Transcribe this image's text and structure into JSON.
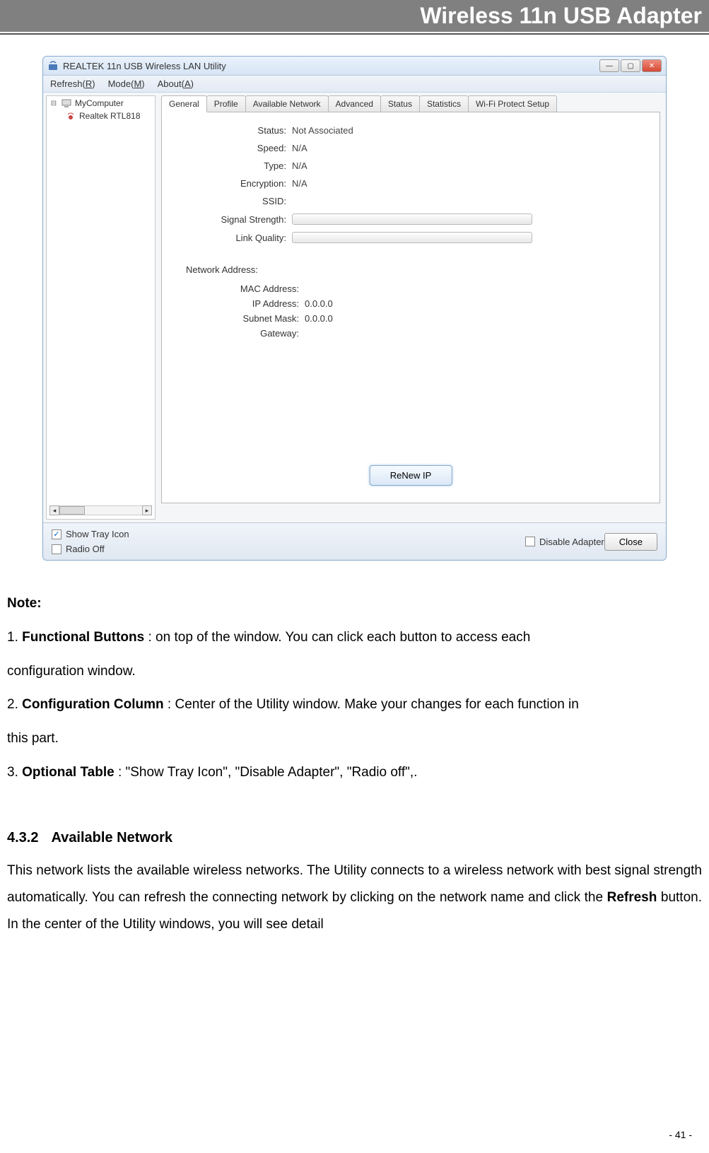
{
  "header": {
    "title": "Wireless 11n USB Adapter"
  },
  "app": {
    "window_title": "REALTEK 11n USB Wireless LAN Utility",
    "menubar": {
      "refresh": "Refresh(R)",
      "mode": "Mode(M)",
      "about": "About(A)"
    },
    "tree": {
      "root": "MyComputer",
      "child": "Realtek RTL818"
    },
    "tabs": {
      "general": "General",
      "profile": "Profile",
      "available_network": "Available Network",
      "advanced": "Advanced",
      "status": "Status",
      "statistics": "Statistics",
      "wifi_protect": "Wi-Fi Protect Setup"
    },
    "general": {
      "status_label": "Status:",
      "status_value": "Not Associated",
      "speed_label": "Speed:",
      "speed_value": "N/A",
      "type_label": "Type:",
      "type_value": "N/A",
      "encryption_label": "Encryption:",
      "encryption_value": "N/A",
      "ssid_label": "SSID:",
      "ssid_value": "",
      "signal_label": "Signal Strength:",
      "link_label": "Link Quality:",
      "network_address_label": "Network Address:",
      "mac_label": "MAC Address:",
      "mac_value": "",
      "ip_label": "IP Address:",
      "ip_value": "0.0.0.0",
      "subnet_label": "Subnet Mask:",
      "subnet_value": "0.0.0.0",
      "gateway_label": "Gateway:",
      "gateway_value": "",
      "renew_button": "ReNew IP"
    },
    "bottom": {
      "show_tray": "Show Tray Icon",
      "radio_off": "Radio Off",
      "disable_adapter": "Disable Adapter",
      "close": "Close"
    }
  },
  "doc": {
    "note_heading": "Note:",
    "item1_prefix": "1. ",
    "item1_bold": "Functional Buttons",
    "item1_rest": " : on top of the window. You can click each button to access each",
    "item1_line2": "configuration window.",
    "item2_prefix": "2. ",
    "item2_bold": "Configuration Column",
    "item2_rest": " : Center of the Utility window. Make your changes for each function in",
    "item2_line2": "this part.",
    "item3_prefix": "3. ",
    "item3_bold": "Optional Table",
    "item3_rest": " : \"Show Tray Icon\", \"Disable Adapter\", \"Radio off\",.",
    "section_num": "4.3.2",
    "section_title": "Available Network",
    "section_body_1": "This network lists the available wireless networks. The Utility connects to a wireless network with best signal strength automatically. You can refresh the connecting network by clicking on the network name and click the ",
    "section_body_bold": "Refresh",
    "section_body_2": " button. In the center of the Utility windows, you will see detail",
    "page_num": "- 41 -"
  }
}
